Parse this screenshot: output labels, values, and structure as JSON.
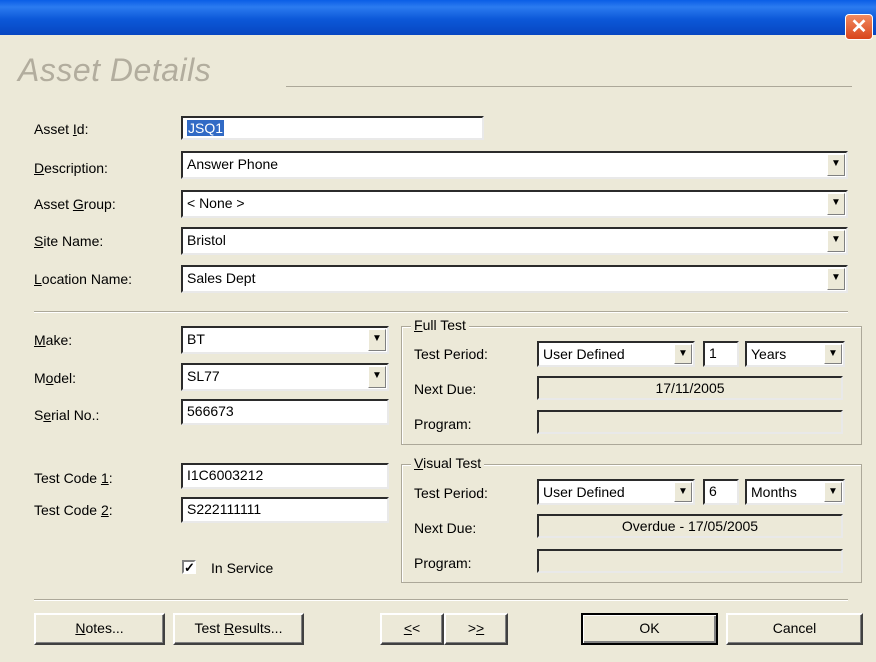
{
  "window": {
    "close_glyph": "✕"
  },
  "header": {
    "title": "Asset Details"
  },
  "asset": {
    "asset_id_label_pre": "Asset ",
    "asset_id_label_key": "I",
    "asset_id_label_post": "d:",
    "asset_id_value": "JSQ1",
    "description_label_key": "D",
    "description_label_post": "escription:",
    "description_value": "Answer Phone",
    "asset_group_label_pre": "Asset ",
    "asset_group_label_key": "G",
    "asset_group_label_post": "roup:",
    "asset_group_value": "< None >",
    "site_name_label_key": "S",
    "site_name_label_post": "ite Name:",
    "site_name_value": "Bristol",
    "location_label_key": "L",
    "location_label_post": "ocation Name:",
    "location_value": "Sales Dept"
  },
  "device": {
    "make_label_key": "M",
    "make_label_post": "ake:",
    "make_value": "BT",
    "model_label_pre": "M",
    "model_label_key": "o",
    "model_label_post": "del:",
    "model_value": "SL77",
    "serial_label_pre": "S",
    "serial_label_key": "e",
    "serial_label_post": "rial No.:",
    "serial_value": "566673",
    "test_code1_label_pre": "Test Code ",
    "test_code1_label_key": "1",
    "test_code1_label_post": ":",
    "test_code1_value": "I1C6003212",
    "test_code2_label_pre": "Test Code ",
    "test_code2_label_key": "2",
    "test_code2_label_post": ":",
    "test_code2_value": "S222111111",
    "in_service_label": "In Service",
    "in_service_checked": true,
    "check_glyph": "✓"
  },
  "full_test": {
    "title_key": "F",
    "title_post": "ull Test",
    "test_period_label": "Test Period:",
    "period_type": "User Defined",
    "period_count": "1",
    "period_unit": "Years",
    "next_due_label": "Next Due:",
    "next_due_value": "17/11/2005",
    "program_label": "Program:",
    "program_value": ""
  },
  "visual_test": {
    "title_key": "V",
    "title_post": "isual Test",
    "test_period_label": "Test Period:",
    "period_type": "User Defined",
    "period_count": "6",
    "period_unit": "Months",
    "next_due_label": "Next Due:",
    "next_due_value": "Overdue - 17/05/2005",
    "program_label": "Program:",
    "program_value": ""
  },
  "buttons": {
    "notes_key": "N",
    "notes_post": "otes...",
    "test_results_pre": "Test ",
    "test_results_key": "R",
    "test_results_post": "esults...",
    "prev_key": "<",
    "prev_post": "<",
    "next_pre": ">",
    "next_key": ">",
    "ok": "OK",
    "cancel": "Cancel"
  },
  "colors": {
    "titlebar": "#0a5ee6",
    "dialog_bg": "#ece9d8",
    "selection": "#316ac5",
    "close": "#d9441c"
  },
  "icons": {
    "dropdown": "chevron-down-icon",
    "close": "close-icon",
    "check": "checkmark-icon"
  }
}
